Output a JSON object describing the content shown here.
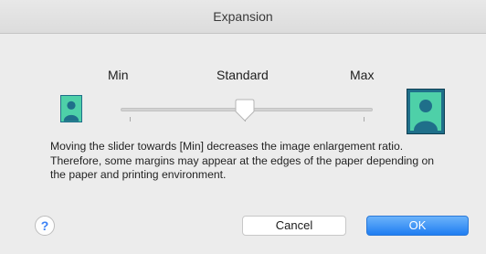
{
  "window": {
    "title": "Expansion"
  },
  "slider": {
    "labels": {
      "min": "Min",
      "standard": "Standard",
      "max": "Max"
    },
    "position_label": "Standard"
  },
  "icons": {
    "small": "person-portrait-small-icon",
    "large": "person-portrait-large-icon",
    "help": "help-icon"
  },
  "message": "Moving the slider towards [Min] decreases the image enlargement ratio. Therefore, some margins may appear at the edges of the paper depending on the paper and printing environment.",
  "buttons": {
    "help": "?",
    "cancel": "Cancel",
    "ok": "OK"
  },
  "colors": {
    "accent": "#1f7df2",
    "avatar_bg": "#4ed0a8",
    "avatar_figure": "#1f6f8a"
  }
}
